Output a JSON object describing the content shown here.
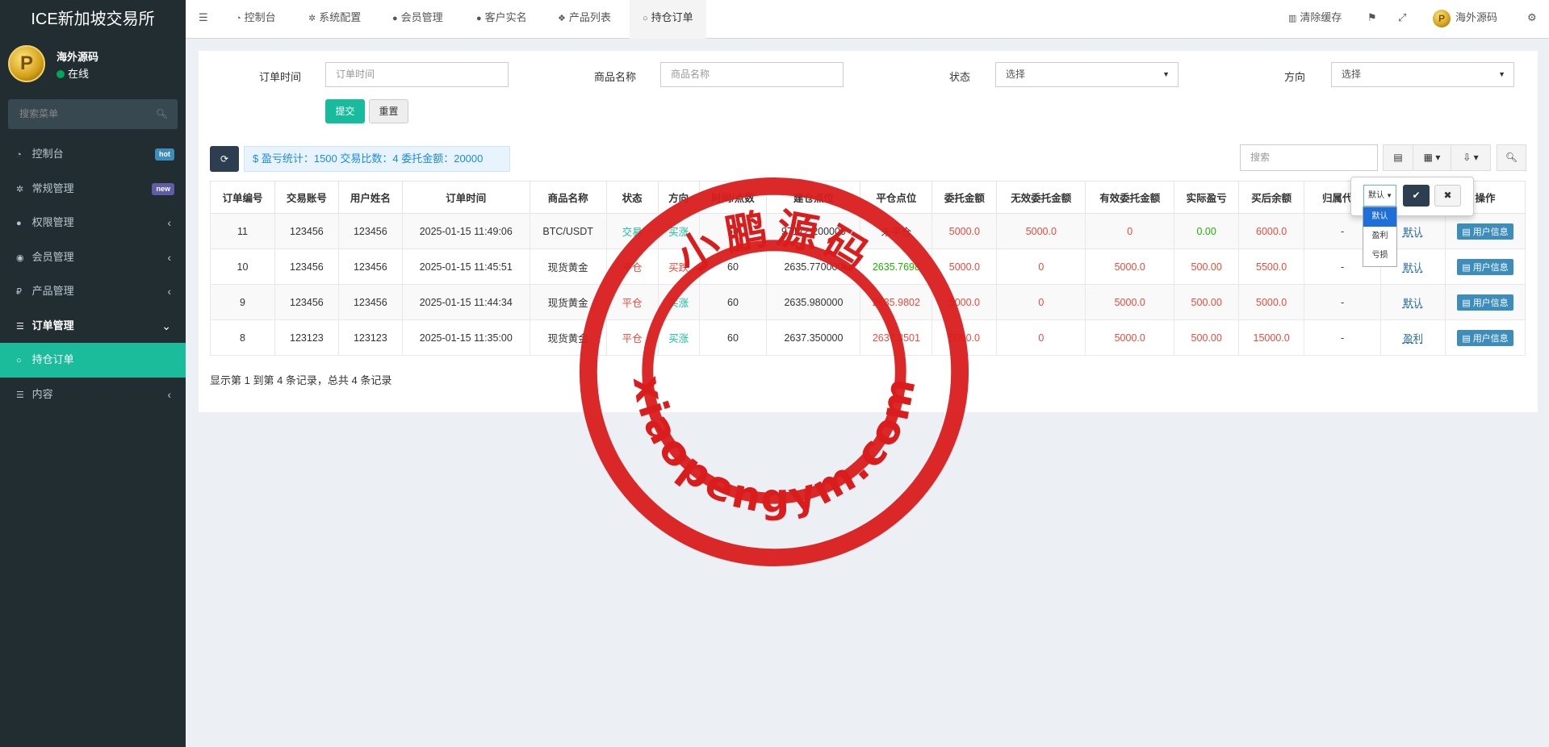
{
  "app_title": "ICE新加坡交易所",
  "user": {
    "name": "海外源码",
    "status": "在线",
    "avatar_letter": "P"
  },
  "sidebar": {
    "search_placeholder": "搜索菜单",
    "items": [
      {
        "label": "控制台",
        "icon": "dashboard-icon",
        "badge": "hot",
        "badge_color": "#3c8dbc"
      },
      {
        "label": "常规管理",
        "icon": "cogs-icon",
        "badge": "new",
        "badge_color": "#605ca8"
      },
      {
        "label": "权限管理",
        "icon": "group-icon"
      },
      {
        "label": "会员管理",
        "icon": "user-circle-icon"
      },
      {
        "label": "产品管理",
        "icon": "ruble-icon"
      },
      {
        "label": "订单管理",
        "icon": "list-icon"
      },
      {
        "label": "持仓订单",
        "icon": "circle-icon"
      },
      {
        "label": "内容",
        "icon": "list-icon"
      }
    ]
  },
  "topnav": {
    "tabs": [
      "控制台",
      "系统配置",
      "会员管理",
      "客户实名",
      "产品列表",
      "持仓订单"
    ],
    "active_tab": "持仓订单",
    "clear_cache": "清除缓存",
    "username": "海外源码"
  },
  "filters": {
    "order_time_label": "订单时间",
    "order_time_placeholder": "订单时间",
    "product_label": "商品名称",
    "product_placeholder": "商品名称",
    "status_label": "状态",
    "status_value": "选择",
    "direction_label": "方向",
    "direction_value": "选择",
    "submit": "提交",
    "reset": "重置"
  },
  "stats": "$ 盈亏统计：1500 交易比数：4 委托金额：20000",
  "table_search_placeholder": "搜索",
  "table": {
    "headers": [
      "订单编号",
      "交易账号",
      "用户姓名",
      "订单时间",
      "商品名称",
      "状态",
      "方向",
      "时间/点数",
      "建仓点位",
      "平仓点位",
      "委托金额",
      "无效委托金额",
      "有效委托金额",
      "实际盈亏",
      "买后余额",
      "归属代理",
      "",
      "操作"
    ],
    "rows": [
      {
        "id": "11",
        "account": "123456",
        "name": "123456",
        "time": "2025-01-15 11:49:06",
        "product": "BTC/USDT",
        "status": "交易",
        "direction": "买涨",
        "points": "60",
        "open": "97172.200000",
        "close": "未平仓",
        "amount": "5000.0",
        "invalid": "5000.0",
        "valid": "0",
        "pnl": "0.00",
        "balance": "6000.0",
        "agent": "-",
        "control": "默认",
        "action": "用户信息"
      },
      {
        "id": "10",
        "account": "123456",
        "name": "123456",
        "time": "2025-01-15 11:45:51",
        "product": "现货黄金",
        "status": "平仓",
        "direction": "买跌",
        "points": "60",
        "open": "2635.770000",
        "close": "2635.7698",
        "amount": "5000.0",
        "invalid": "0",
        "valid": "5000.0",
        "pnl": "500.00",
        "balance": "5500.0",
        "agent": "-",
        "control": "默认",
        "action": "用户信息"
      },
      {
        "id": "9",
        "account": "123456",
        "name": "123456",
        "time": "2025-01-15 11:44:34",
        "product": "现货黄金",
        "status": "平仓",
        "direction": "买涨",
        "points": "60",
        "open": "2635.980000",
        "close": "2635.9802",
        "amount": "5000.0",
        "invalid": "0",
        "valid": "5000.0",
        "pnl": "500.00",
        "balance": "5000.0",
        "agent": "-",
        "control": "默认",
        "action": "用户信息"
      },
      {
        "id": "8",
        "account": "123123",
        "name": "123123",
        "time": "2025-01-15 11:35:00",
        "product": "现货黄金",
        "status": "平仓",
        "direction": "买涨",
        "points": "60",
        "open": "2637.350000",
        "close": "2637.3501",
        "amount": "5000.0",
        "invalid": "0",
        "valid": "5000.0",
        "pnl": "500.00",
        "balance": "15000.0",
        "agent": "-",
        "control": "盈利",
        "action": "用户信息"
      }
    ]
  },
  "footer": "显示第 1 到第 4 条记录，总共 4 条记录",
  "popover": {
    "select_value": "默认",
    "options": [
      "默认",
      "盈利",
      "亏损"
    ]
  },
  "watermark": {
    "top_text": "小鹏源码",
    "bottom_text": "xiaopengym.com",
    "color": "#d91c1c"
  }
}
